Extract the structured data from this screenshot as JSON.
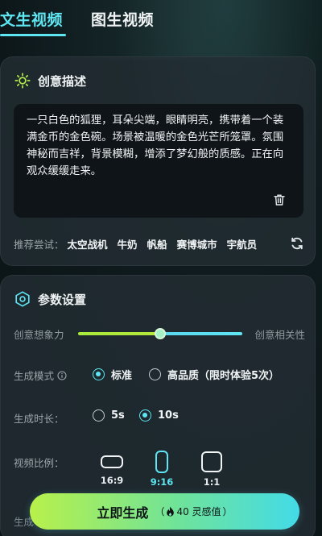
{
  "tabs": [
    {
      "label": "文生视频",
      "active": true
    },
    {
      "label": "图生视频",
      "active": false
    }
  ],
  "creative": {
    "title": "创意描述",
    "prompt": "一只白色的狐狸，耳朵尖端，眼睛明亮，携带着一个装满金币的金色碗。场景被温暖的金色光芒所笼罩。氛围神秘而吉祥，背景模糊，增添了梦幻般的质感。正在向观众缓缓走来。",
    "suggest_label": "推荐尝试：",
    "suggestions": [
      "太空战机",
      "牛奶",
      "帆船",
      "赛博城市",
      "宇航员"
    ]
  },
  "params": {
    "title": "参数设置",
    "slider": {
      "left_label": "创意想象力",
      "right_label": "创意相关性",
      "value": 0.5
    },
    "mode": {
      "label": "生成模式",
      "options": [
        "标准",
        "高品质（限时体验5次）"
      ],
      "selected": 0
    },
    "duration": {
      "label": "生成时长：",
      "options": [
        "5s",
        "10s"
      ],
      "selected": 1
    },
    "ratio": {
      "label": "视频比例：",
      "options": [
        "16:9",
        "9:16",
        "1:1"
      ],
      "selected": 1
    },
    "next_label_partial": "生成"
  },
  "generate": {
    "label": "立即生成",
    "cost": "40 灵感值",
    "cost_open": "（",
    "cost_close": "）"
  },
  "colors": {
    "accent": "#5ee6f2",
    "lime": "#b8f04a"
  }
}
